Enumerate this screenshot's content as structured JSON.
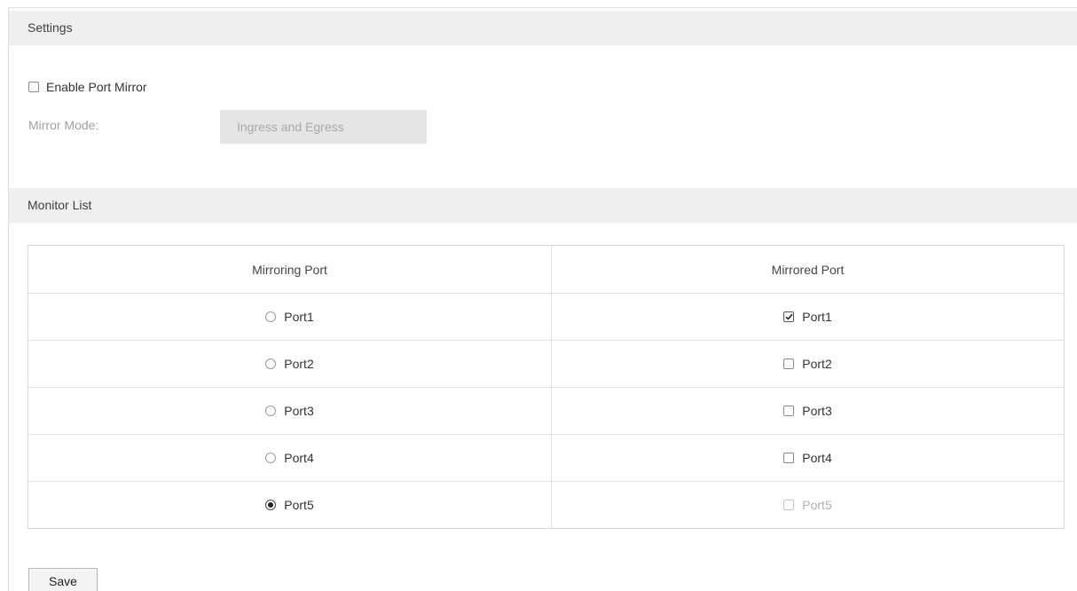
{
  "settings": {
    "header": "Settings",
    "enable_port_mirror": {
      "label": "Enable Port Mirror",
      "checked": false
    },
    "mirror_mode": {
      "label": "Mirror Mode:",
      "value": "Ingress and Egress"
    }
  },
  "monitor_list": {
    "header": "Monitor List",
    "columns": [
      "Mirroring Port",
      "Mirrored Port"
    ],
    "rows": [
      {
        "mirroring": {
          "label": "Port1",
          "selected": false
        },
        "mirrored": {
          "label": "Port1",
          "checked": true,
          "disabled": false
        }
      },
      {
        "mirroring": {
          "label": "Port2",
          "selected": false
        },
        "mirrored": {
          "label": "Port2",
          "checked": false,
          "disabled": false
        }
      },
      {
        "mirroring": {
          "label": "Port3",
          "selected": false
        },
        "mirrored": {
          "label": "Port3",
          "checked": false,
          "disabled": false
        }
      },
      {
        "mirroring": {
          "label": "Port4",
          "selected": false
        },
        "mirrored": {
          "label": "Port4",
          "checked": false,
          "disabled": false
        }
      },
      {
        "mirroring": {
          "label": "Port5",
          "selected": true
        },
        "mirrored": {
          "label": "Port5",
          "checked": false,
          "disabled": true
        }
      }
    ]
  },
  "actions": {
    "save_label": "Save"
  }
}
